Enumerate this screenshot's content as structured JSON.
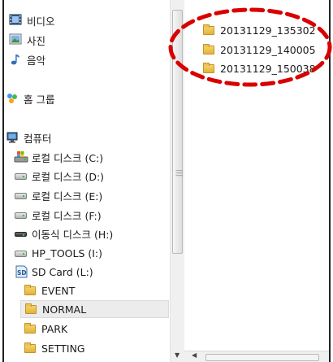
{
  "nav": {
    "items": [
      {
        "label": "비디오",
        "icon": "video-library-icon"
      },
      {
        "label": "사진",
        "icon": "pictures-library-icon"
      },
      {
        "label": "음악",
        "icon": "music-library-icon"
      },
      {
        "label": "홈 그룹",
        "icon": "homegroup-icon"
      },
      {
        "label": "컴퓨터",
        "icon": "computer-icon"
      },
      {
        "label": "로컬 디스크 (C:)",
        "icon": "system-drive-icon"
      },
      {
        "label": "로컬 디스크 (D:)",
        "icon": "hard-drive-icon"
      },
      {
        "label": "로컬 디스크 (E:)",
        "icon": "hard-drive-icon"
      },
      {
        "label": "로컬 디스크 (F:)",
        "icon": "hard-drive-icon"
      },
      {
        "label": "이동식 디스크 (H:)",
        "icon": "removable-drive-icon"
      },
      {
        "label": "HP_TOOLS (I:)",
        "icon": "hard-drive-icon"
      },
      {
        "label": "SD Card (L:)",
        "icon": "sd-card-icon"
      },
      {
        "label": "EVENT",
        "icon": "folder-icon"
      },
      {
        "label": "NORMAL",
        "icon": "folder-icon",
        "selected": true
      },
      {
        "label": "PARK",
        "icon": "folder-icon"
      },
      {
        "label": "SETTING",
        "icon": "folder-icon"
      }
    ]
  },
  "files": {
    "items": [
      {
        "name": "20131129_135302",
        "icon": "folder-icon"
      },
      {
        "name": "20131129_140005",
        "icon": "folder-icon"
      },
      {
        "name": "20131129_150038",
        "icon": "folder-icon"
      }
    ]
  },
  "colors": {
    "annotation": "#d90000",
    "selection": "#ececec",
    "folder": "#e9c453"
  }
}
